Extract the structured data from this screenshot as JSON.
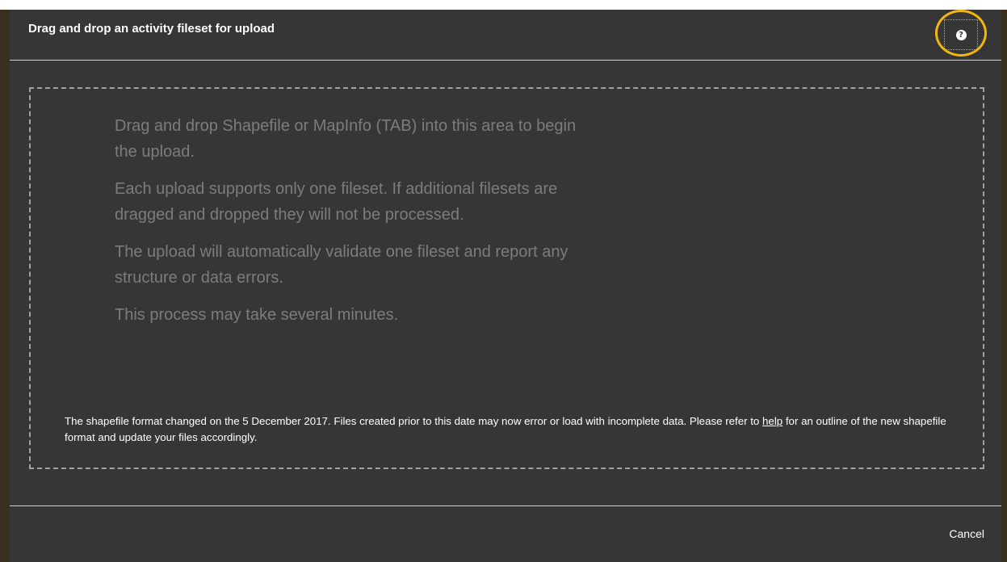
{
  "dialog": {
    "title": "Drag and drop an activity fileset for upload",
    "help_icon": "question-circle-icon",
    "accent_color": "#f1b70e"
  },
  "dropzone": {
    "paragraphs": [
      "Drag and drop Shapefile or MapInfo (TAB) into this area to begin the upload.",
      "Each upload supports only one fileset. If additional filesets are dragged and dropped they will not be processed.",
      "The upload will automatically validate one fileset and report any structure or data errors.",
      "This process may take several minutes."
    ]
  },
  "notice": {
    "text_before_link": "The shapefile format changed on the 5 December 2017. Files created prior to this date may now error or load with incomplete data. Please refer to ",
    "link_text": "help",
    "text_after_link": " for an outline of the new shapefile format and update your files accordingly."
  },
  "footer": {
    "cancel_label": "Cancel"
  }
}
